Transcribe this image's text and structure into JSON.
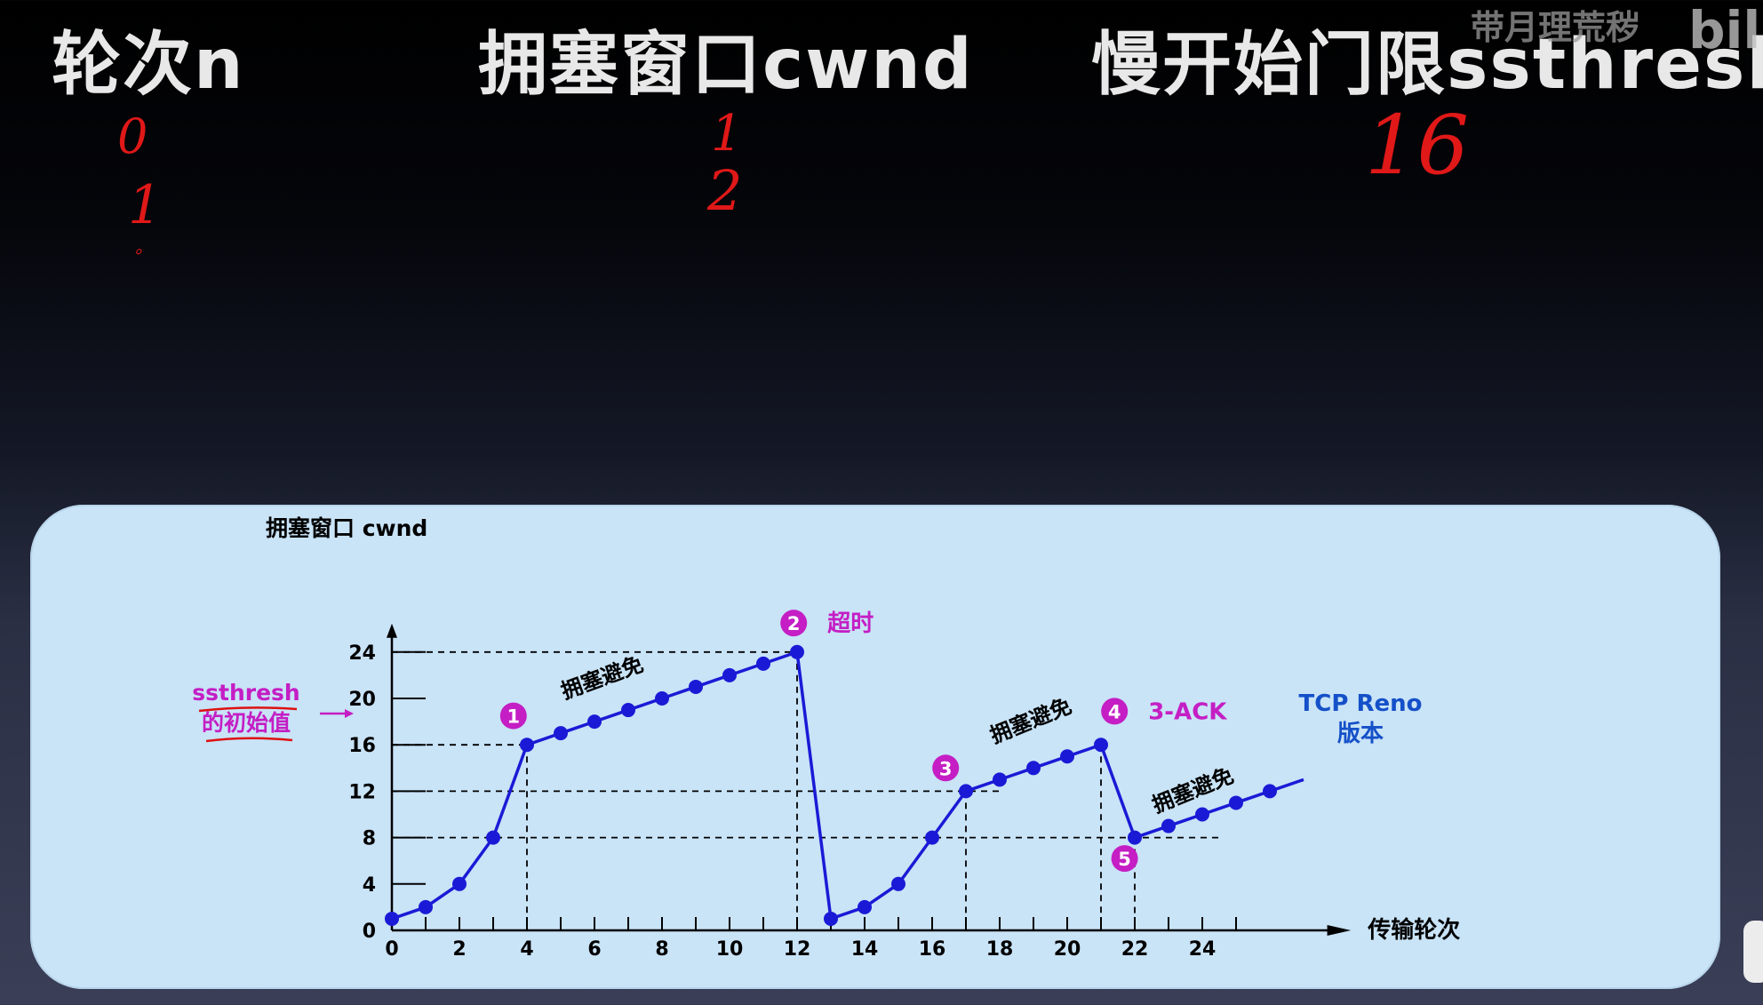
{
  "headers": {
    "round": "轮次n",
    "cwnd": "拥塞窗口cwnd",
    "ssthresh": "慢开始门限ssthresh"
  },
  "handwriting": {
    "round_values": [
      "0",
      "1",
      "。"
    ],
    "cwnd_values": [
      "1",
      "2"
    ],
    "ssthresh_value": "16"
  },
  "watermark": {
    "text": "带月理荒秽",
    "logo": "bili"
  },
  "colors": {
    "handwriting": "#e01818",
    "series": "#1a1ad6",
    "annotation": "#c41ec4",
    "panel": "#c9e3f7",
    "reno": "#1450c8"
  },
  "chart_data": {
    "type": "line",
    "ylabel": "拥塞窗口  cwnd",
    "xlabel": "传输轮次",
    "ylim": [
      0,
      24
    ],
    "xlim": [
      0,
      25
    ],
    "y_ticks": [
      "0",
      "4",
      "8",
      "12",
      "16",
      "20",
      "24"
    ],
    "x_ticks": [
      "0",
      "2",
      "4",
      "6",
      "8",
      "10",
      "12",
      "14",
      "16",
      "18",
      "20",
      "22",
      "24"
    ],
    "series": [
      {
        "x": [
          0,
          1,
          2,
          3,
          4,
          5,
          6,
          7,
          8,
          9,
          10,
          11,
          12,
          13,
          14,
          15,
          16,
          17,
          18,
          19,
          20,
          21,
          22,
          23,
          24,
          25,
          26
        ],
        "y": [
          1,
          2,
          4,
          8,
          16,
          17,
          18,
          19,
          20,
          21,
          22,
          23,
          24,
          1,
          2,
          4,
          8,
          12,
          13,
          14,
          15,
          16,
          8,
          9,
          10,
          11,
          12
        ]
      }
    ],
    "tail_arrow_to": [
      27,
      13
    ],
    "reference_lines_y": [
      8,
      12,
      16,
      24
    ],
    "reference_lines_x": [
      4,
      12,
      17,
      21,
      22
    ],
    "markers": [
      {
        "id": "1",
        "label": ""
      },
      {
        "id": "2",
        "label": "超时"
      },
      {
        "id": "3",
        "label": ""
      },
      {
        "id": "4",
        "label": "3-ACK"
      },
      {
        "id": "5",
        "label": ""
      }
    ],
    "phase_labels": [
      "拥塞避免",
      "拥塞避免",
      "拥塞避免"
    ],
    "annotations": {
      "ssthresh_line1": "ssthresh",
      "ssthresh_line2": "的初始值",
      "reno_line1": "TCP Reno",
      "reno_line2": "版本"
    }
  }
}
